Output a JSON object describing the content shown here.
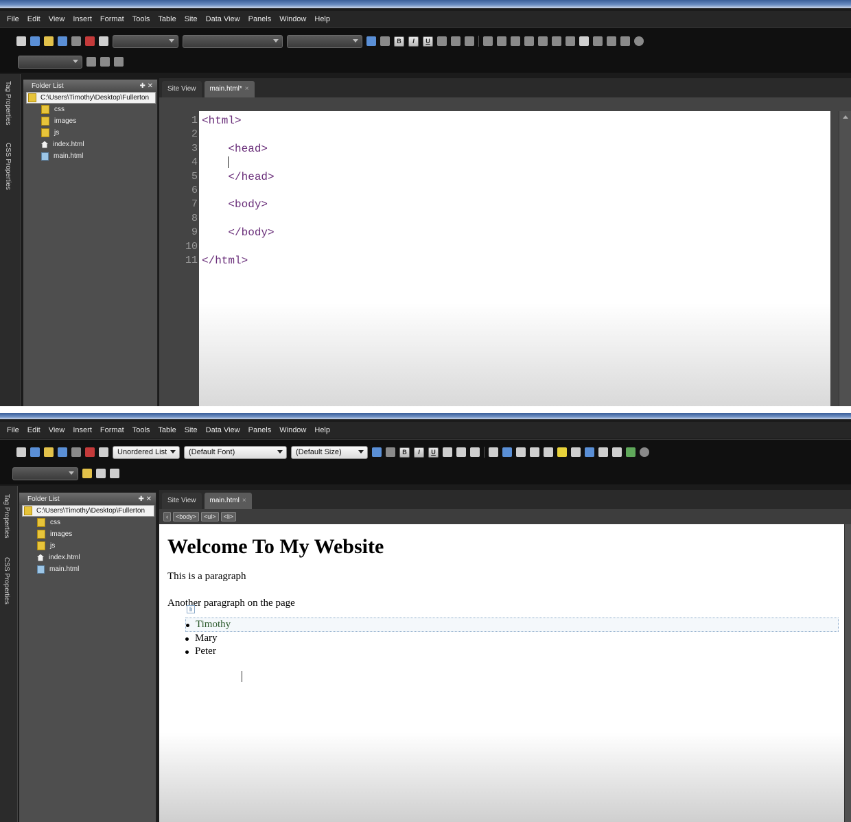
{
  "menu": [
    "File",
    "Edit",
    "View",
    "Insert",
    "Format",
    "Tools",
    "Table",
    "Site",
    "Data View",
    "Panels",
    "Window",
    "Help"
  ],
  "shot1": {
    "side_tabs": [
      "Tag Properties",
      "CSS Properties"
    ],
    "folder_panel": {
      "title": "Folder List",
      "path": "C:\\Users\\Timothy\\Desktop\\Fullerton",
      "items": [
        {
          "name": "css",
          "type": "folder"
        },
        {
          "name": "images",
          "type": "folder"
        },
        {
          "name": "js",
          "type": "folder"
        },
        {
          "name": "index.html",
          "type": "home"
        },
        {
          "name": "main.html",
          "type": "file"
        }
      ]
    },
    "tabs": [
      "Site View",
      "main.html*"
    ],
    "line_numbers": [
      "1",
      "2",
      "3",
      "4",
      "5",
      "6",
      "7",
      "8",
      "9",
      "10",
      "11"
    ],
    "code_lines": [
      "<html>",
      "",
      "    <head>",
      "    ",
      "    </head>",
      "",
      "    <body>",
      "",
      "    </body>",
      "",
      "</html>"
    ]
  },
  "shot2": {
    "style_dropdown": "Unordered List",
    "font_dropdown": "(Default Font)",
    "size_dropdown": "(Default Size)",
    "side_tabs": [
      "Tag Properties",
      "CSS Properties"
    ],
    "folder_panel": {
      "title": "Folder List",
      "path": "C:\\Users\\Timothy\\Desktop\\Fullerton",
      "items": [
        {
          "name": "css",
          "type": "folder"
        },
        {
          "name": "images",
          "type": "folder"
        },
        {
          "name": "js",
          "type": "folder"
        },
        {
          "name": "index.html",
          "type": "home"
        },
        {
          "name": "main.html",
          "type": "file"
        }
      ]
    },
    "tabs": [
      "Site View",
      "main.html"
    ],
    "breadcrumbs": [
      "<body>",
      "<ul>",
      "<li>"
    ],
    "page": {
      "heading": "Welcome To My Website",
      "paragraphs": [
        "This is a paragraph",
        "Another paragraph on the page"
      ],
      "li_tag": "li",
      "list_items": [
        "Timothy",
        "Mary",
        "Peter"
      ]
    }
  },
  "toolbar_format_buttons": [
    "B",
    "I",
    "U"
  ],
  "colors": {
    "menubar": "#262626",
    "toolbar": "#101010",
    "panel": "#4e4e4e",
    "editor_bg": "#ffffff",
    "code_tag": "#6a2f7a"
  }
}
